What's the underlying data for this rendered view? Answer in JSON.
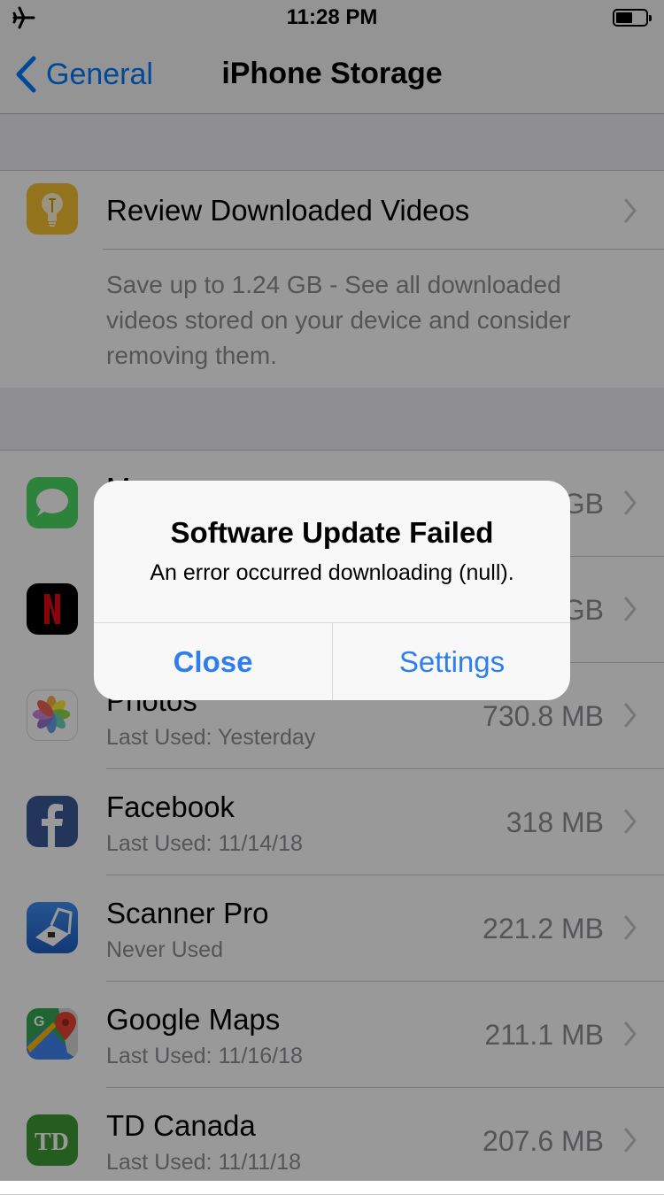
{
  "status_bar": {
    "time": "11:28 PM",
    "airplane_mode": true,
    "battery_level": 0.5
  },
  "nav": {
    "back_label": "General",
    "title": "iPhone Storage"
  },
  "recommendation": {
    "icon": "lightbulb-icon",
    "title": "Review Downloaded Videos",
    "description": "Save up to 1.24 GB - See all downloaded videos stored on your device and consider removing them."
  },
  "apps": [
    {
      "name": "M",
      "icon": "messages-icon",
      "subtitle": "",
      "size": "GB",
      "color": "#4cd964"
    },
    {
      "name": "",
      "icon": "netflix-icon",
      "subtitle": "",
      "size": "GB",
      "color": "#000000"
    },
    {
      "name": "Photos",
      "icon": "photos-icon",
      "subtitle": "Last Used: Yesterday",
      "size": "730.8 MB",
      "color": "#ffffff"
    },
    {
      "name": "Facebook",
      "icon": "facebook-icon",
      "subtitle": "Last Used: 11/14/18",
      "size": "318 MB",
      "color": "#3b5998"
    },
    {
      "name": "Scanner Pro",
      "icon": "scanner-pro-icon",
      "subtitle": "Never Used",
      "size": "221.2 MB",
      "color": "#2a6fd1"
    },
    {
      "name": "Google Maps",
      "icon": "google-maps-icon",
      "subtitle": "Last Used: 11/16/18",
      "size": "211.1 MB",
      "color": "#4285f4"
    },
    {
      "name": "TD Canada",
      "icon": "td-canada-icon",
      "subtitle": "Last Used: 11/11/18",
      "size": "207.6 MB",
      "color": "#3c9b35"
    }
  ],
  "alert": {
    "title": "Software Update Failed",
    "message": "An error occurred downloading (null).",
    "buttons": {
      "close": "Close",
      "settings": "Settings"
    },
    "button_color": "#2f7ef0"
  }
}
